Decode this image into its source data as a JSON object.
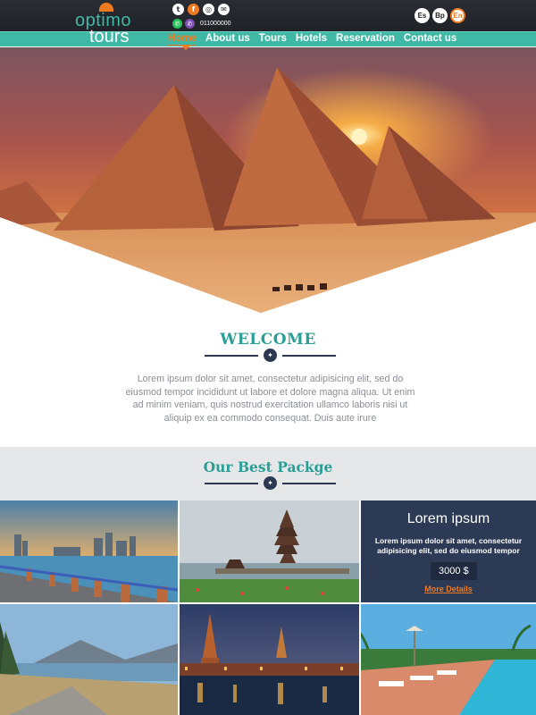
{
  "header": {
    "logo_line1": "optimo",
    "logo_line2": "tours",
    "social_icons": [
      "twitter-icon",
      "facebook-icon",
      "instagram-icon",
      "mail-icon"
    ],
    "contact_icons": [
      "whatsapp-icon",
      "viber-icon"
    ],
    "phone": "011000000",
    "languages": [
      "Es",
      "Bp",
      "En"
    ],
    "active_language": "En"
  },
  "nav": {
    "items": [
      "Home",
      "About us",
      "Tours",
      "Hotels",
      "Reservation",
      "Contact us"
    ],
    "active": "Home"
  },
  "hero": {
    "image": "pyramids-at-sunset"
  },
  "welcome": {
    "title": "WELCOME",
    "body": "Lorem ipsum dolor sit amet, consectetur adipisicing elit, sed do eiusmod tempor incididunt ut labore et dolore magna aliqua. Ut enim ad minim veniam, quis nostrud exercitation ullamco laboris nisi ut aliquip ex ea commodo consequat. Duis aute irure"
  },
  "packages": {
    "title": "Our Best Packge",
    "tiles": [
      "city-harbor-photo",
      "water-temple-photo",
      "lake-mountains-photo",
      "night-kremlin-photo",
      "resort-pool-photo"
    ],
    "promo": {
      "title": "Lorem ipsum",
      "text": "Lorem ipsum dolor sit amet, consectetur adipisicing elit, sed do eiusmod tempor",
      "price": "3000 $",
      "link": "More Details"
    }
  },
  "colors": {
    "teal": "#3fb8a6",
    "orange": "#f07a1f",
    "navy": "#2c3a55",
    "dark": "#2a2d33"
  }
}
